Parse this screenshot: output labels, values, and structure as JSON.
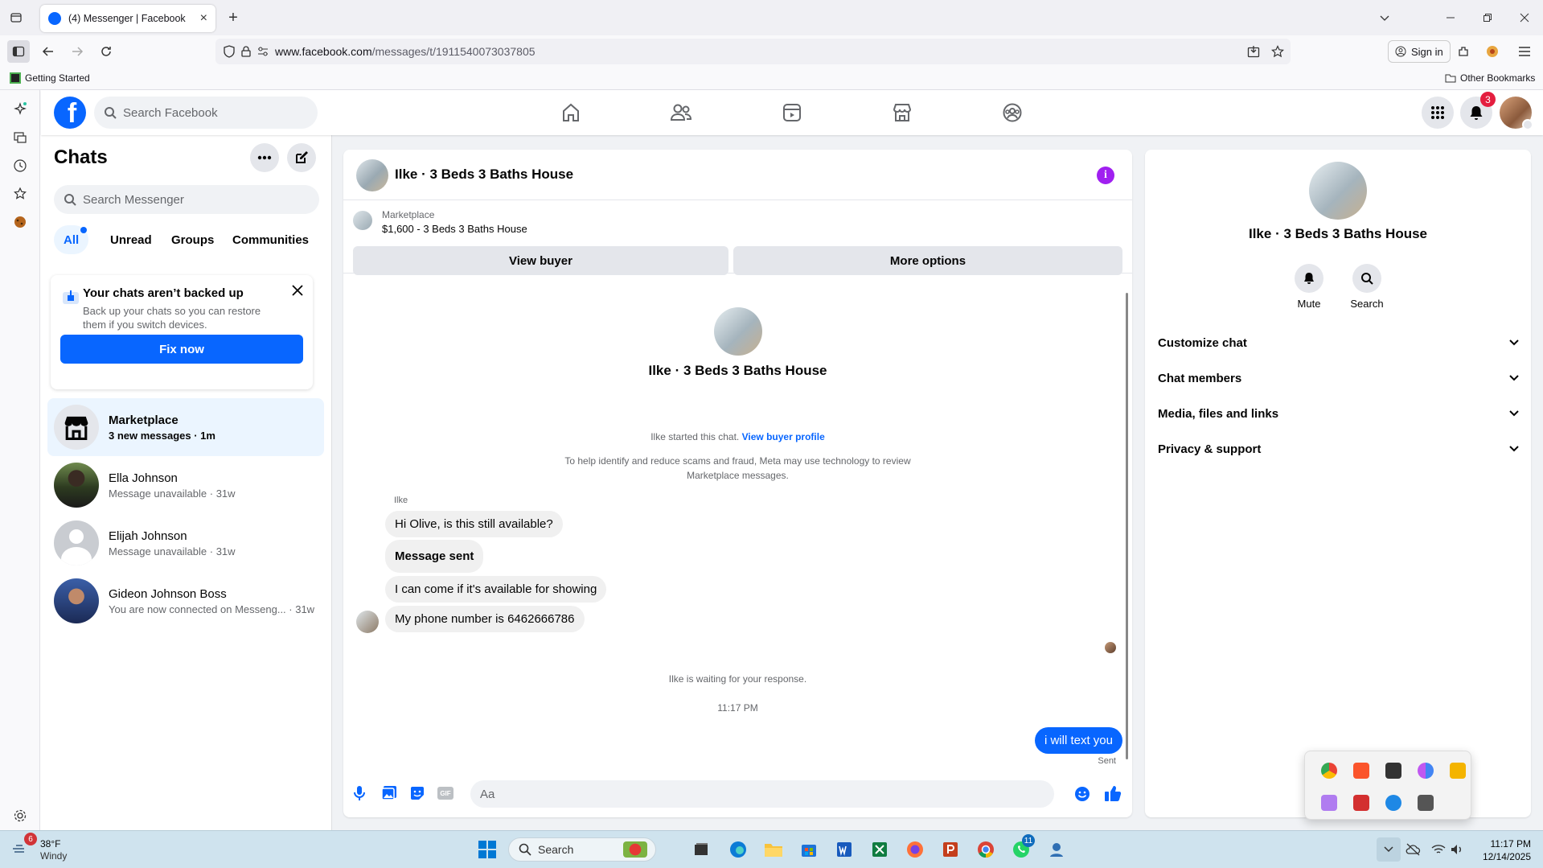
{
  "browser": {
    "tab_title": "(4) Messenger | Facebook",
    "url_domain": "www.facebook.com",
    "url_path": "/messages/t/1911540073037805",
    "sign_in": "Sign in",
    "bookmark_getting_started": "Getting Started",
    "bookmark_other": "Other Bookmarks"
  },
  "fbnav": {
    "logo": "f",
    "search_placeholder": "Search Facebook",
    "notification_count": "3"
  },
  "chats": {
    "title": "Chats",
    "search_placeholder": "Search Messenger",
    "filters": [
      "All",
      "Unread",
      "Groups",
      "Communities"
    ],
    "backup": {
      "title": "Your chats aren’t backed up",
      "desc": "Back up your chats so you can restore them if you switch devices.",
      "button": "Fix now"
    },
    "items": [
      {
        "name": "Marketplace",
        "preview": "3 new messages · 1m"
      },
      {
        "name": "Ella Johnson",
        "preview": "Message unavailable · 31w"
      },
      {
        "name": "Elijah Johnson",
        "preview": "Message unavailable · 31w"
      },
      {
        "name": "Gideon Johnson Boss",
        "preview": "You are now connected on Messeng... · 31w"
      }
    ]
  },
  "conversation": {
    "title": "Ilke · 3 Beds 3 Baths House",
    "marketplace_label": "Marketplace",
    "listing": "$1,600 - 3 Beds 3 Baths House",
    "view_buyer": "View buyer",
    "more_options": "More options",
    "profile_name": "Ilke · 3 Beds 3 Baths House",
    "started_text": "Ilke started this chat.",
    "view_buyer_profile": "View buyer profile",
    "scam_notice": "To help identify and reduce scams and fraud, Meta may use technology to review Marketplace messages.",
    "sender": "Ilke",
    "messages": [
      "Hi Olive, is this still available?",
      "Message sent",
      "I can come if it's available for showing",
      "My phone number is 6462666786"
    ],
    "waiting": "Ilke is waiting for your response.",
    "time": "11:17 PM",
    "my_message": "i will text you",
    "status": "Sent",
    "composer_placeholder": "Aa"
  },
  "info": {
    "name": "Ilke · 3 Beds 3 Baths House",
    "mute": "Mute",
    "search": "Search",
    "sections": [
      "Customize chat",
      "Chat members",
      "Media, files and links",
      "Privacy & support"
    ]
  },
  "taskbar": {
    "weather_badge": "6",
    "temp": "38°F",
    "condition": "Windy",
    "search": "Search",
    "whatsapp_badge": "11",
    "time": "11:17 PM",
    "date": "12/14/2025"
  },
  "colors": {
    "brand": "#0866ff",
    "purple_info": "#a020f0"
  }
}
